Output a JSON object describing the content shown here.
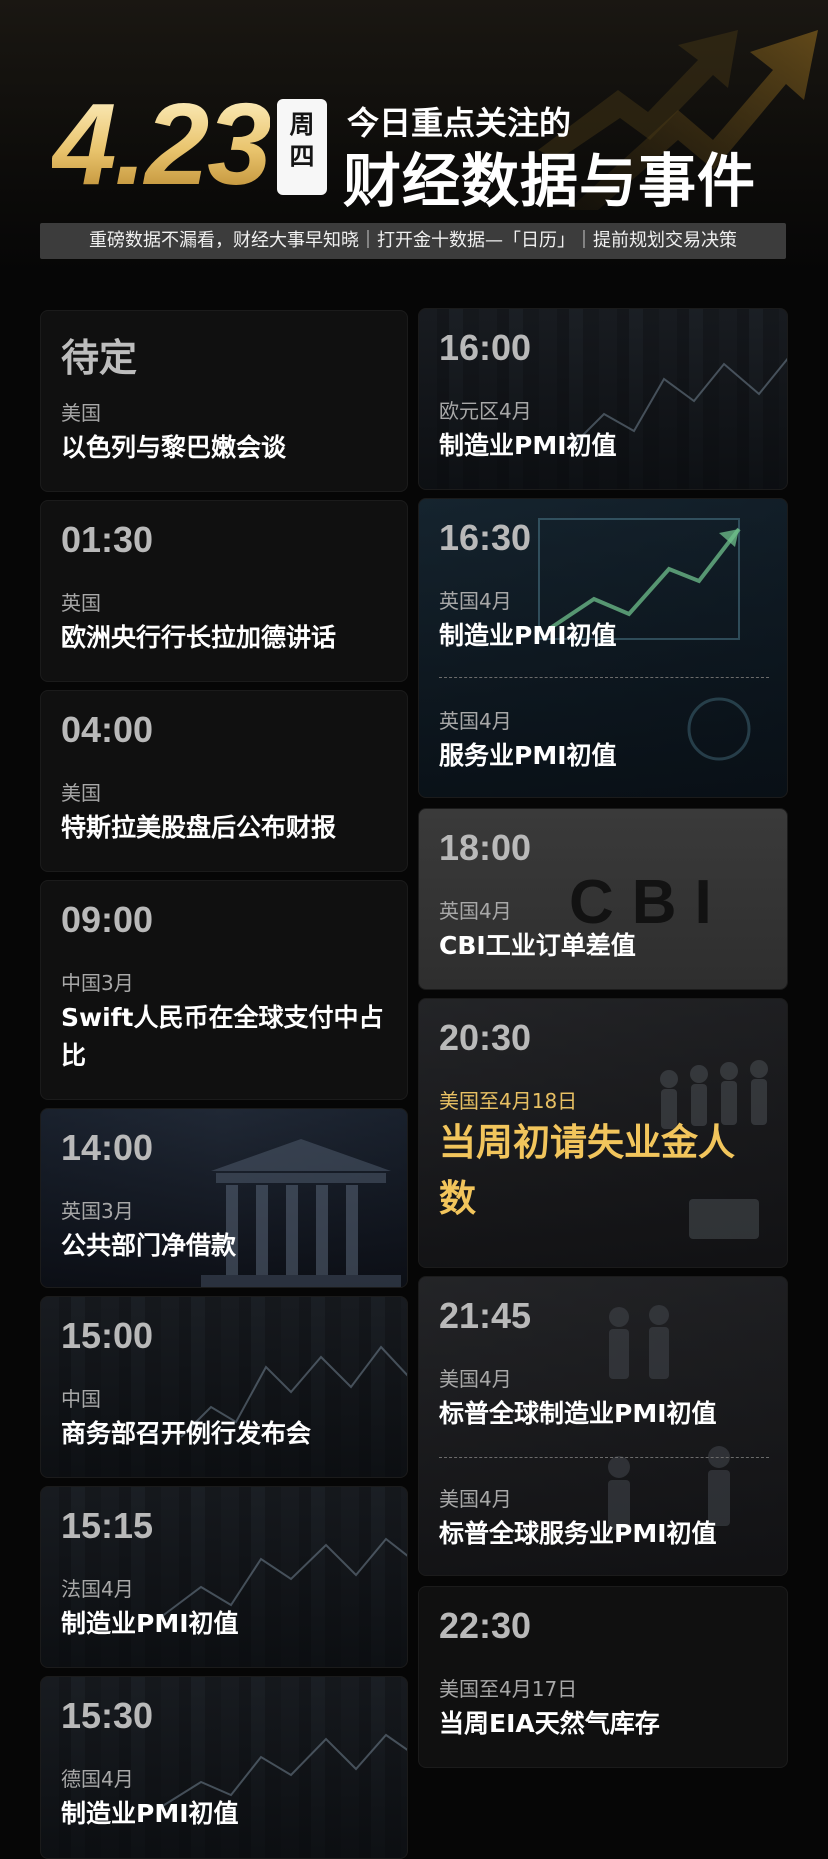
{
  "header": {
    "date": "4.23",
    "weekday": "周四",
    "headline_line1": "今日重点关注的",
    "headline_line2": "财经数据与事件",
    "banner": "重磅数据不漏看，财经大事早知晓｜打开金十数据—「日历」｜提前规划交易决策"
  },
  "left_column": [
    {
      "time": "待定",
      "region": "美国",
      "event": "以色列与黎巴嫩会谈"
    },
    {
      "time": "01:30",
      "region": "英国",
      "event": "欧洲央行行长拉加德讲话"
    },
    {
      "time": "04:00",
      "region": "美国",
      "event": "特斯拉美股盘后公布财报"
    },
    {
      "time": "09:00",
      "region": "中国3月",
      "event": "Swift人民币在全球支付中占比"
    },
    {
      "time": "14:00",
      "region": "英国3月",
      "event": "公共部门净借款"
    },
    {
      "time": "15:00",
      "region": "中国",
      "event": "商务部召开例行发布会"
    },
    {
      "time": "15:15",
      "region": "法国4月",
      "event": "制造业PMI初值"
    },
    {
      "time": "15:30",
      "region": "德国4月",
      "event": "制造业PMI初值"
    }
  ],
  "right_column": [
    {
      "time": "16:00",
      "items": [
        {
          "region": "欧元区4月",
          "event": "制造业PMI初值"
        }
      ]
    },
    {
      "time": "16:30",
      "items": [
        {
          "region": "英国4月",
          "event": "制造业PMI初值"
        },
        {
          "region": "英国4月",
          "event": "服务业PMI初值"
        }
      ]
    },
    {
      "time": "18:00",
      "logo": "CBI",
      "items": [
        {
          "region": "英国4月",
          "event": "CBI工业订单差值"
        }
      ]
    },
    {
      "time": "20:30",
      "items": [
        {
          "region": "美国至4月18日",
          "event": "当周初请失业金人数",
          "highlight": true
        }
      ]
    },
    {
      "time": "21:45",
      "items": [
        {
          "region": "美国4月",
          "event": "标普全球制造业PMI初值"
        },
        {
          "region": "美国4月",
          "event": "标普全球服务业PMI初值"
        }
      ]
    },
    {
      "time": "22:30",
      "items": [
        {
          "region": "美国至4月17日",
          "event": "当周EIA天然气库存"
        }
      ]
    }
  ],
  "colors": {
    "accent_gold": "#e8c063",
    "background": "#060606",
    "card": "#101010"
  }
}
